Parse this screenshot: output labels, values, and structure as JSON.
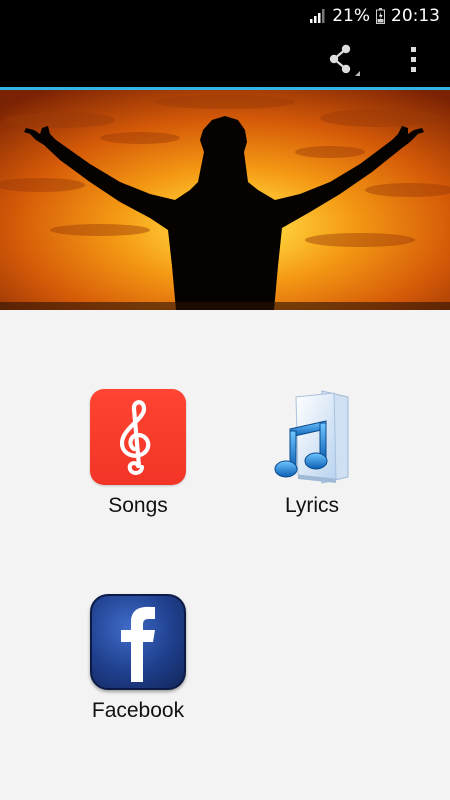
{
  "status_bar": {
    "battery_percent": "21%",
    "time": "20:13",
    "icons": [
      "signal-icon",
      "battery-icon"
    ]
  },
  "action_bar": {
    "icons": [
      "share-icon",
      "overflow-menu-icon"
    ],
    "accent_color": "#33b5e5"
  },
  "banner": {
    "image": "silhouette-praising-sunset"
  },
  "menu": {
    "items": [
      {
        "label": "Songs",
        "icon": "treble-clef-icon"
      },
      {
        "label": "Lyrics",
        "icon": "music-note-folder-icon"
      },
      {
        "label": "Facebook",
        "icon": "facebook-icon"
      }
    ]
  },
  "colors": {
    "background": "#f3f3f3",
    "songs_red": "#f23526",
    "facebook_blue": "#1f3f8d"
  }
}
